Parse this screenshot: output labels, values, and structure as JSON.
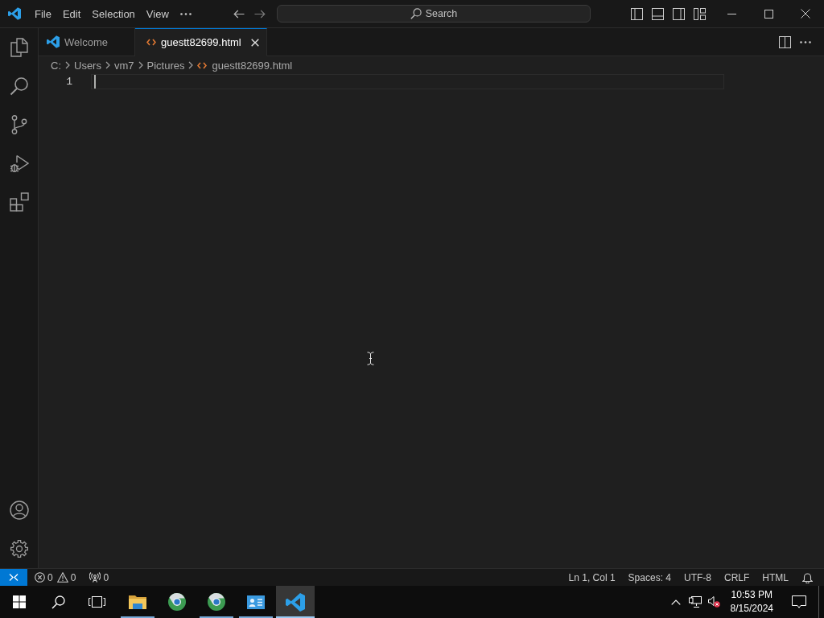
{
  "title_bar": {
    "menu": [
      "File",
      "Edit",
      "Selection",
      "View"
    ],
    "search": {
      "placeholder": "Search"
    }
  },
  "tabs": [
    {
      "label": "Welcome",
      "kind": "welcome",
      "selected": false
    },
    {
      "label": "guestt82699.html",
      "kind": "html",
      "selected": true
    }
  ],
  "breadcrumbs": [
    {
      "label": "C:",
      "kind": "folder"
    },
    {
      "label": "Users",
      "kind": "folder"
    },
    {
      "label": "vm7",
      "kind": "folder"
    },
    {
      "label": "Pictures",
      "kind": "folder"
    },
    {
      "label": "guestt82699.html",
      "kind": "html"
    }
  ],
  "editor": {
    "lines": [
      {
        "number": "1",
        "current": true
      }
    ]
  },
  "status_bar": {
    "problems": {
      "errors": "0",
      "warnings": "0"
    },
    "ports": "0",
    "items": [
      "Ln 1, Col 1",
      "Spaces: 4",
      "UTF-8",
      "CRLF",
      "HTML"
    ]
  },
  "taskbar": {
    "apps": [
      {
        "kind": "file-explorer",
        "running": true,
        "selected": false
      },
      {
        "kind": "browser",
        "running": false,
        "selected": false
      },
      {
        "kind": "browser",
        "running": true,
        "selected": false
      },
      {
        "kind": "contact-card",
        "running": true,
        "selected": false
      },
      {
        "kind": "code-editor",
        "running": true,
        "selected": true
      }
    ],
    "clock": {
      "time": "10:53 PM",
      "date": "8/15/2024"
    }
  }
}
